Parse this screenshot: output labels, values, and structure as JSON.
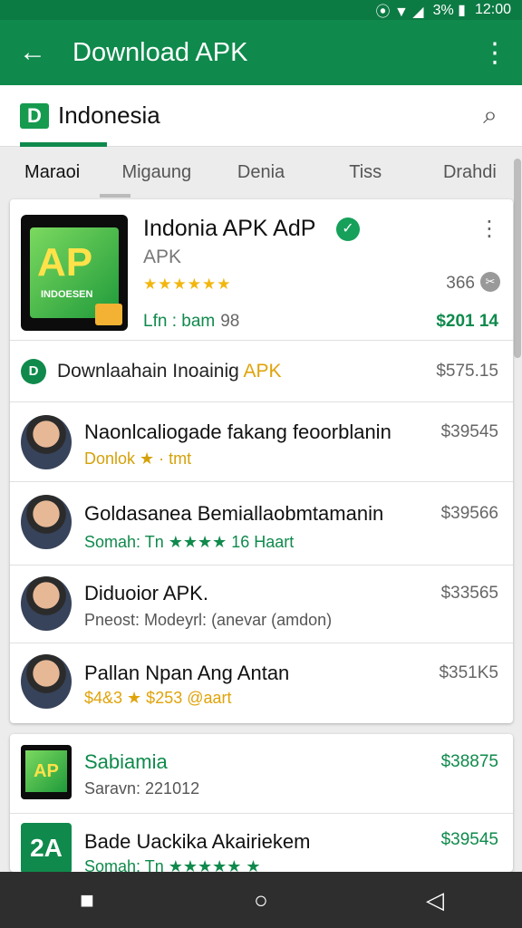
{
  "status": {
    "icons": "⦿ ▼ ◢",
    "battery": "3% ▮",
    "time": "12:00"
  },
  "app_bar": {
    "title": "Download APK",
    "back_icon": "←",
    "more_icon": "⋮"
  },
  "country": {
    "flag_letter": "D",
    "name": "Indonesia",
    "search_icon": "⌕"
  },
  "tabs": [
    "Maraoi",
    "Migaung",
    "Denia",
    "Tiss",
    "Drahdi"
  ],
  "featured": {
    "icon_text": "AP",
    "icon_subtext": "INDOESEN",
    "title": "Indonia APK AdP",
    "subtitle": "APK",
    "stars": "★★★★★★",
    "count": "366",
    "meta_label": "Lfn : bam",
    "meta_num": "98",
    "price": "$201 14",
    "verified_icon": "✓"
  },
  "download": {
    "icon": "D",
    "label": "Downlaahain Inoainig",
    "accent": "APK",
    "price": "$575.15"
  },
  "list1": [
    {
      "name": "Naonlcaliogade fakang feoorblanin",
      "sub": "Donlok ★ · tmt",
      "sub_color": "#d4a10a",
      "price": "$39545"
    },
    {
      "name": "Goldasanea Bemiallaobmtamanin",
      "sub": "Somah: Tn ★★★★ 16  Haart",
      "sub_color": "#0f8a4c",
      "price": "$39566"
    },
    {
      "name": "Diduoior APK.",
      "sub": "Pneost: Modeyrl: (anevar (amdon)",
      "sub_color": "#555555",
      "price": "$33565"
    },
    {
      "name": "Pallan Npan Ang Antan",
      "sub": "$4&3 ★  $253  @aart",
      "sub_color": "#e0a30a",
      "price": "$351K5"
    }
  ],
  "list2": [
    {
      "icon": "AP",
      "name": "Sabiamia",
      "sub": "Saravn: 221012",
      "price": "$38875"
    },
    {
      "icon": "2A",
      "name": "Bade Uackika Akairiekem",
      "sub": "Somah: Tn ★★★★★  ★",
      "price": "$39545"
    }
  ],
  "nav": {
    "recent_icon": "■",
    "home_icon": "○",
    "back_icon": "◁"
  }
}
